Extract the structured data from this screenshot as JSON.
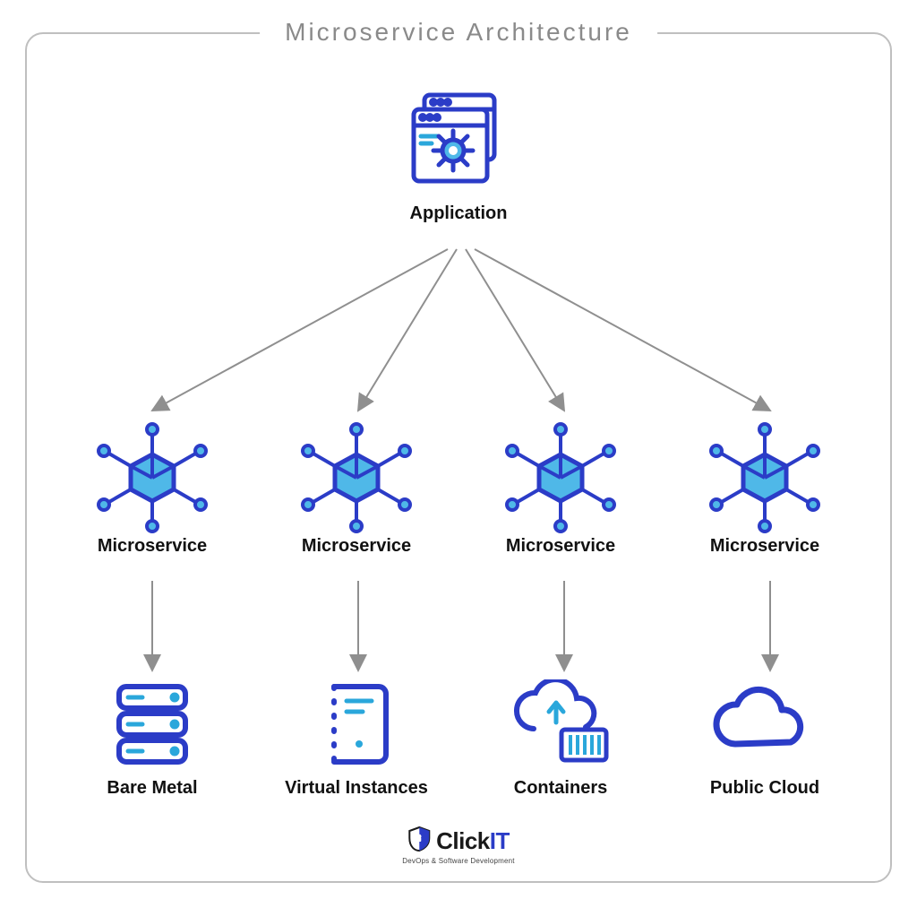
{
  "title": "Microservice Architecture",
  "application": {
    "label": "Application"
  },
  "microservices": [
    {
      "label": "Microservice"
    },
    {
      "label": "Microservice"
    },
    {
      "label": "Microservice"
    },
    {
      "label": "Microservice"
    }
  ],
  "infra": [
    {
      "label": "Bare Metal",
      "icon": "server-stack-icon"
    },
    {
      "label": "Virtual Instances",
      "icon": "vm-icon"
    },
    {
      "label": "Containers",
      "icon": "cloud-container-icon"
    },
    {
      "label": "Public Cloud",
      "icon": "cloud-icon"
    }
  ],
  "brand": {
    "name_a": "Click",
    "name_b": "IT",
    "tagline": "DevOps & Software Development"
  },
  "colors": {
    "dark_blue": "#2b3cc7",
    "light_blue": "#2aa7db",
    "cyan_fill": "#4fb8e8",
    "border_grey": "#bfbfbf",
    "title_grey": "#8a8a8a",
    "arrow_grey": "#8f8f8f"
  }
}
